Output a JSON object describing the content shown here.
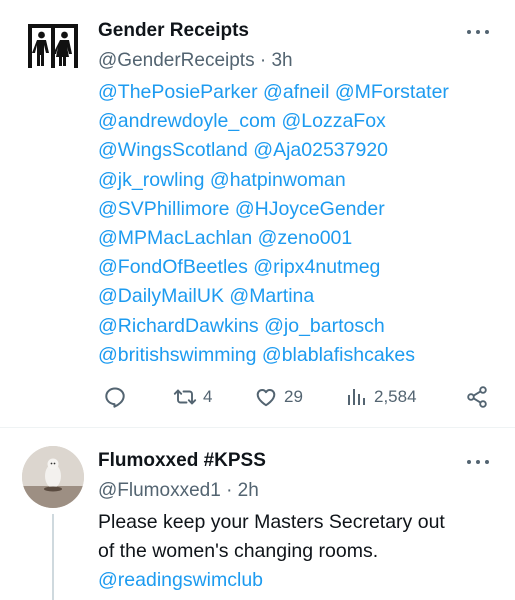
{
  "tweet1": {
    "author_name": "Gender Receipts",
    "handle": "@GenderReceipts",
    "separator": "·",
    "time": "3h",
    "mentions": [
      "@ThePosieParker @afneil @MForstater",
      "@andrewdoyle_com @LozzaFox",
      "@WingsScotland @Aja02537920",
      "@jk_rowling @hatpinwoman",
      "@SVPhillimore @HJoyceGender",
      "@MPMacLachlan @zeno001",
      "@FondOfBeetles @ripx4nutmeg",
      "@DailyMailUK @Martina",
      "@RichardDawkins @jo_bartosch",
      "@britishswimming @blablafishcakes"
    ],
    "retweet_count": "4",
    "like_count": "29",
    "view_count": "2,584"
  },
  "tweet2": {
    "author_name": "Flumoxxed #KPSS",
    "handle": "@Flumoxxed1",
    "separator": "·",
    "time": "2h",
    "body_lines": [
      "Please keep your Masters Secretary out",
      "of the women's changing rooms."
    ],
    "link": "@readingswimclub"
  },
  "icons": {
    "reply": "reply-icon",
    "retweet": "retweet-icon",
    "like": "heart-icon",
    "views": "analytics-icon",
    "share": "share-icon",
    "more": "more-icon",
    "restroom": "restroom-icon"
  },
  "colors": {
    "link": "#1d9bf0",
    "text": "#0f1419",
    "secondary": "#536471",
    "divider": "#eff3f4"
  }
}
